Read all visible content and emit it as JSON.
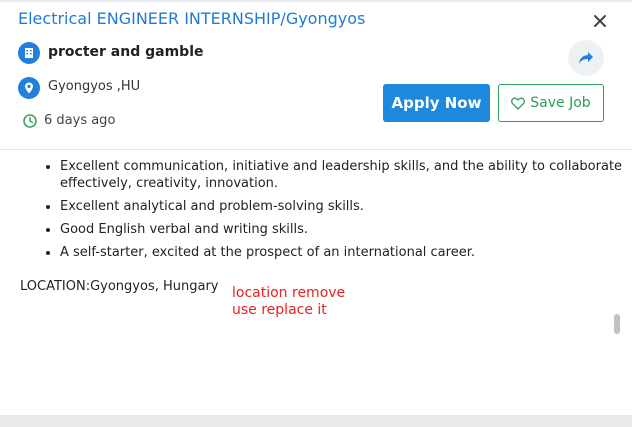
{
  "job": {
    "title": "Electrical ENGINEER INTERNSHIP/Gyongyos",
    "company": "procter and gamble",
    "location": "Gyongyos ,HU",
    "posted": "6 days ago"
  },
  "actions": {
    "apply_label": "Apply Now",
    "save_label": "Save Job"
  },
  "description": {
    "requirements": [
      "Excellent communication, initiative and leadership skills, and the ability to collaborate effectively, creativity, innovation.",
      "Excellent analytical and problem-solving skills.",
      "Good English verbal and writing skills.",
      "A self-starter, excited at the prospect of an international career."
    ],
    "location_line": "LOCATION:Gyongyos, Hungary"
  },
  "annotation": {
    "line1": "location remove",
    "line2": "use replace it"
  },
  "colors": {
    "title": "#1f7bd6",
    "apply_button": "#1e88dc",
    "save_button": "#2e9d5a",
    "annotation": "#e8221e"
  },
  "icons": [
    "close-icon",
    "building-icon",
    "location-pin-icon",
    "clock-icon",
    "share-icon",
    "heart-icon"
  ]
}
